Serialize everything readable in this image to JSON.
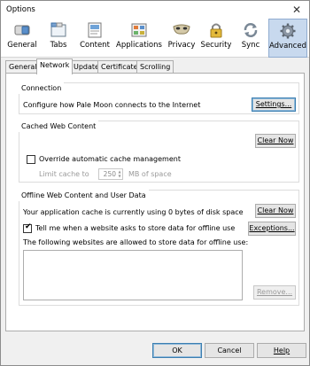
{
  "window": {
    "title": "Options",
    "close_glyph": "✕"
  },
  "toolbar": {
    "items": [
      {
        "label": "General",
        "icon": "switch-icon"
      },
      {
        "label": "Tabs",
        "icon": "tabs-icon"
      },
      {
        "label": "Content",
        "icon": "content-icon"
      },
      {
        "label": "Applications",
        "icon": "applications-icon"
      },
      {
        "label": "Privacy",
        "icon": "mask-icon"
      },
      {
        "label": "Security",
        "icon": "padlock-icon"
      },
      {
        "label": "Sync",
        "icon": "sync-icon"
      },
      {
        "label": "Advanced",
        "icon": "gear-icon",
        "selected": true
      }
    ]
  },
  "subtabs": [
    "General",
    "Network",
    "Update",
    "Certificates",
    "Scrolling"
  ],
  "active_subtab": "Network",
  "connection": {
    "title": "Connection",
    "description": "Configure how Pale Moon connects to the Internet",
    "settings_button": "Settings..."
  },
  "cache": {
    "title": "Cached Web Content",
    "clear_button": "Clear Now",
    "override_label": "Override automatic cache management",
    "override_checked": false,
    "limit_label": "Limit cache to",
    "limit_value": "250",
    "limit_unit": "MB of space"
  },
  "offline": {
    "title": "Offline Web Content and User Data",
    "usage_text": "Your application cache is currently using 0 bytes of disk space",
    "clear_button": "Clear Now",
    "tell_me_label": "Tell me when a website asks to store data for offline use",
    "tell_me_checked": true,
    "exceptions_button": "Exceptions...",
    "list_label": "The following websites are allowed to store data for offline use:",
    "remove_button": "Remove..."
  },
  "footer": {
    "ok": "OK",
    "cancel": "Cancel",
    "help": "Help"
  },
  "colors": {
    "selected_tab_bg": "#c8d9ee",
    "default_button_border": "#3c7fb1"
  }
}
